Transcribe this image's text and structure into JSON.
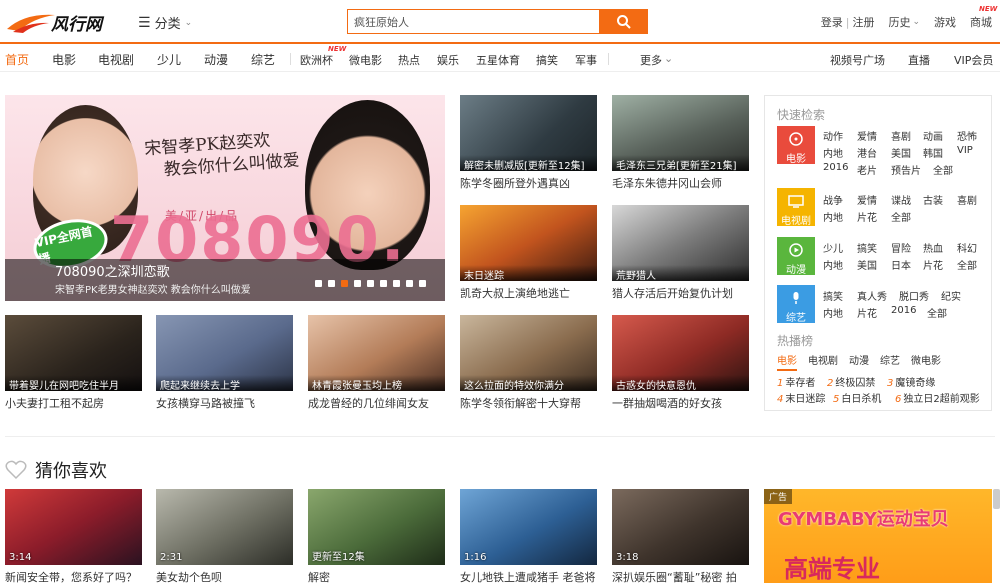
{
  "header": {
    "logo_text": "风行网",
    "category_label": "分类",
    "search_value": "疯狂原始人",
    "links": [
      "登录",
      "注册",
      "历史",
      "游戏",
      "商城"
    ],
    "new_badge": "NEW"
  },
  "nav": {
    "items": [
      "首页",
      "电影",
      "电视剧",
      "少儿",
      "动漫",
      "综艺",
      "欧洲杯",
      "微电影",
      "热点",
      "娱乐",
      "五星体育",
      "搞笑",
      "军事",
      "更多",
      "视频号广场",
      "直播",
      "VIP会员"
    ]
  },
  "hero": {
    "tagline1": "宋智孝PK赵奕欢",
    "tagline2": "教会你什么叫做爱",
    "big": "708090.",
    "sub": "美/亚/出/品",
    "badge": "VIP全网首播",
    "caption_title": "708090之深圳恋歌",
    "caption_sub": "宋智孝PK老男女神赵奕欢 教会你什么叫做爱"
  },
  "cards": [
    {
      "label": "解密未删减版[更新至12集]",
      "title": "陈学冬圈所登外遇真凶"
    },
    {
      "label": "毛泽东三兄弟[更新至21集]",
      "title": "毛泽东朱德井冈山会师"
    },
    {
      "label": "末日迷踪",
      "title": "凯奇大叔上演绝地逃亡"
    },
    {
      "label": "荒野猎人",
      "title": "猎人存活后开始复仇计划"
    },
    {
      "label": "带着婴儿在网吧吃住半月",
      "title": "小夫妻打工租不起房"
    },
    {
      "label": "爬起来继续去上学",
      "title": "女孩横穿马路被撞飞"
    },
    {
      "label": "林青霞张曼玉均上榜",
      "title": "成龙曾经的几位绯闻女友"
    },
    {
      "label": "这么拉面的特效你满分",
      "title": "陈学冬领衔解密十大穿帮"
    },
    {
      "label": "古惑女的快意恩仇",
      "title": "一群抽烟喝酒的好女孩"
    }
  ],
  "panel": {
    "title_quick": "快速检索",
    "title_hot": "热播榜",
    "groups": [
      {
        "name": "电影",
        "rows": [
          [
            "动作",
            "爱情",
            "喜剧",
            "动画",
            "恐怖"
          ],
          [
            "内地",
            "港台",
            "美国",
            "韩国",
            "VIP"
          ],
          [
            "2016",
            "老片",
            "预告片",
            "全部"
          ]
        ]
      },
      {
        "name": "电视剧",
        "rows": [
          [
            "战争",
            "爱情",
            "谍战",
            "古装",
            "喜剧"
          ],
          [
            "内地",
            "片花",
            "全部"
          ]
        ]
      },
      {
        "name": "动漫",
        "rows": [
          [
            "少儿",
            "搞笑",
            "冒险",
            "热血",
            "科幻"
          ],
          [
            "内地",
            "美国",
            "日本",
            "片花",
            "全部"
          ]
        ]
      },
      {
        "name": "综艺",
        "rows": [
          [
            "搞笑",
            "真人秀",
            "脱口秀",
            "纪实"
          ],
          [
            "内地",
            "片花",
            "2016",
            "全部"
          ]
        ]
      }
    ],
    "tabs": [
      "电影",
      "电视剧",
      "动漫",
      "综艺",
      "微电影"
    ],
    "hot": [
      {
        "n": "1",
        "t": "幸存者"
      },
      {
        "n": "2",
        "t": "终极囚禁"
      },
      {
        "n": "3",
        "t": "魔镜奇缘"
      },
      {
        "n": "4",
        "t": "末日迷踪"
      },
      {
        "n": "5",
        "t": "白日杀机"
      },
      {
        "n": "6",
        "t": "独立日2超前观影"
      }
    ]
  },
  "guess": {
    "title": "猜你喜欢",
    "items": [
      {
        "dur": "3:14",
        "title": "新闻安全带，您系好了吗？"
      },
      {
        "dur": "2:31",
        "title": "美女劫个色呗"
      },
      {
        "dur": "更新至12集",
        "title": "解密"
      },
      {
        "dur": "1:16",
        "title": "女儿地铁上遭咸猪手 老爸将"
      },
      {
        "dur": "3:18",
        "title": "深扒娱乐圈“蓄耻”秘密 拍"
      }
    ],
    "ad_tag": "广告",
    "ad_title": "GYMBABY运动宝贝",
    "ad_sub": "高端专业"
  },
  "colors": {
    "accent": "#f36b13",
    "movie": "#e94b3c",
    "tv": "#f5b400",
    "anime": "#5ab63d",
    "variety": "#3b9ce3"
  }
}
